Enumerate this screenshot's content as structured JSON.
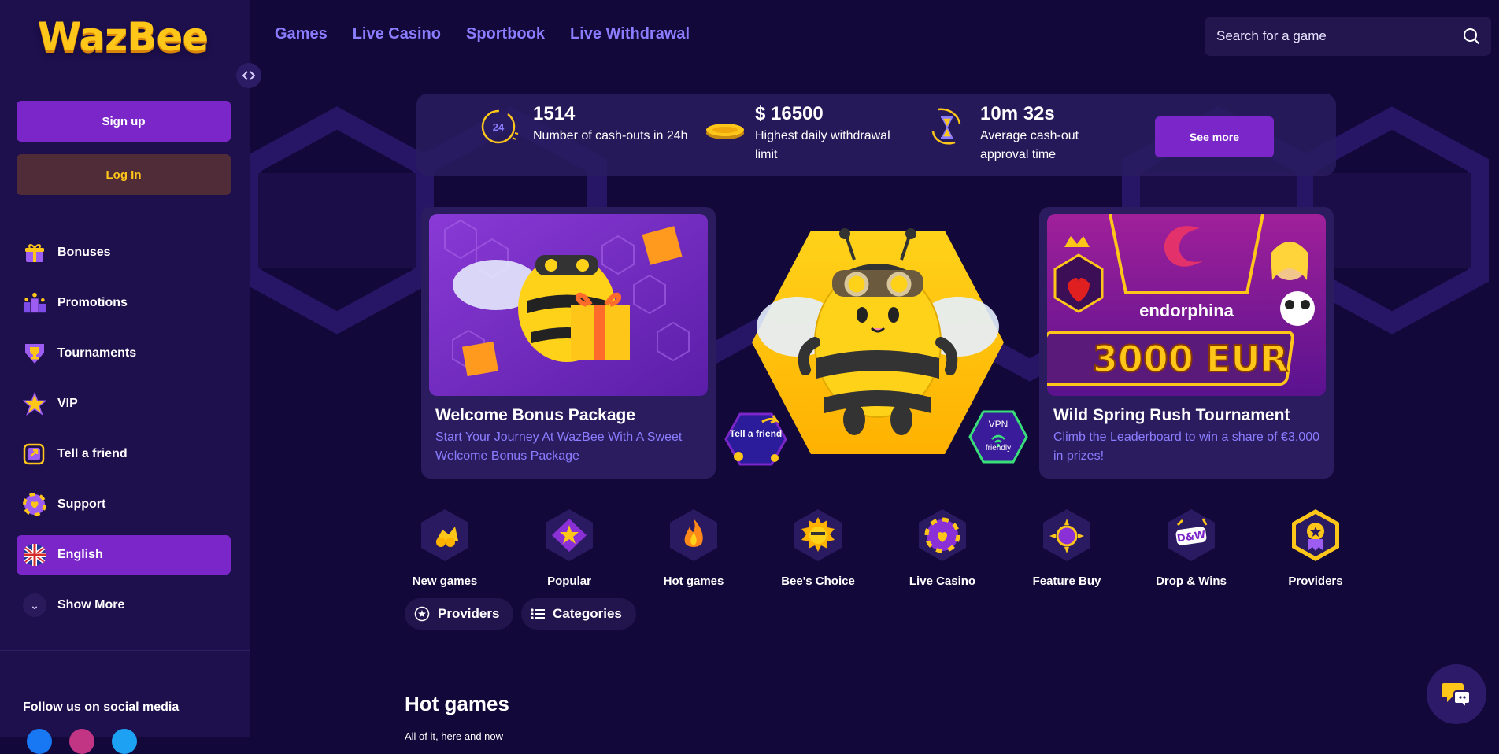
{
  "brand": {
    "name": "WazBee",
    "logo_left": "Wa",
    "logo_mid": "z",
    "logo_right": "Bee"
  },
  "sidebar": {
    "signup_label": "Sign up",
    "login_label": "Log In",
    "items": [
      {
        "label": "Bonuses",
        "icon": "gift-icon"
      },
      {
        "label": "Promotions",
        "icon": "podium-icon"
      },
      {
        "label": "Tournaments",
        "icon": "trophy-icon"
      },
      {
        "label": "VIP",
        "icon": "star-icon"
      },
      {
        "label": "Tell a friend",
        "icon": "share-icon"
      },
      {
        "label": "Support",
        "icon": "lifebuoy-icon"
      },
      {
        "label": "English",
        "icon": "uk-flag-icon"
      },
      {
        "label": "Show More",
        "icon": "chevron-down-icon"
      }
    ],
    "social_title": "Follow us on social media"
  },
  "header": {
    "nav": [
      "Games",
      "Live Casino",
      "Sportbook",
      "Live Withdrawal"
    ],
    "search_placeholder": "Search for a game"
  },
  "stats": [
    {
      "value": "1514",
      "label": "Number of cash-outs in 24h",
      "icon_text": "24"
    },
    {
      "value": "$ 16500",
      "label": "Highest daily withdrawal limit"
    },
    {
      "value": "10m 32s",
      "label": "Average cash-out approval time"
    }
  ],
  "stats_button": "See more",
  "promos": [
    {
      "title": "Welcome Bonus Package",
      "desc": "Start Your Journey At WazBee With A Sweet Welcome Bonus Package"
    },
    {
      "title": "Wild Spring Rush Tournament",
      "desc": "Climb the Leaderboard to win a share of €3,000 in prizes!",
      "image_text_brand": "endorphina",
      "image_text_prize": "3000 EUR"
    }
  ],
  "hero_badges": {
    "tell_friend": "Tell a friend",
    "vpn_top": "VPN",
    "vpn_bottom": "friendly"
  },
  "categories": [
    "New games",
    "Popular",
    "Hot games",
    "Bee's Choice",
    "Live Casino",
    "Feature Buy",
    "Drop & Wins",
    "Providers"
  ],
  "category_badge_dw": "D&W",
  "pills": {
    "providers": "Providers",
    "categories": "Categories"
  },
  "section": {
    "title": "Hot games",
    "subtitle": "All of it, here and now"
  },
  "colors": {
    "bg": "#12083a",
    "sidebar": "#1e0f4d",
    "accent": "#7b26c9",
    "gold": "#ffc61a",
    "link": "#8b7dff"
  }
}
